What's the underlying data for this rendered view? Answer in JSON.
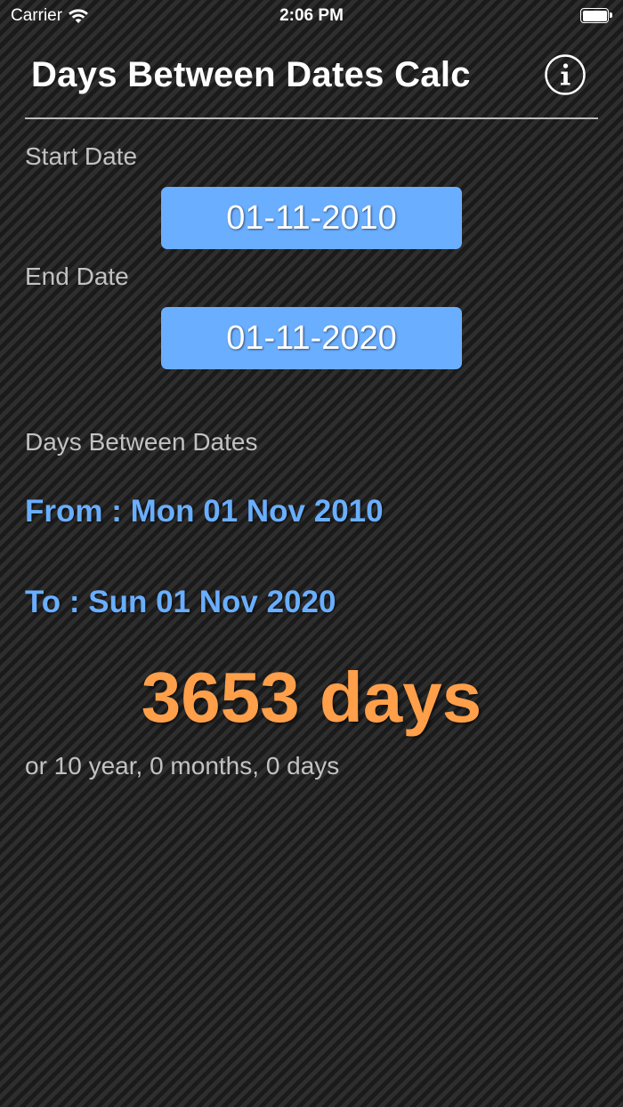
{
  "status_bar": {
    "carrier": "Carrier",
    "time": "2:06 PM",
    "wifi_icon": "wifi-icon",
    "battery_icon": "battery-full-icon"
  },
  "header": {
    "title": "Days Between Dates Calc",
    "info_icon": "info-icon"
  },
  "start": {
    "label": "Start Date",
    "value": "01-11-2010"
  },
  "end": {
    "label": "End Date",
    "value": "01-11-2020"
  },
  "result": {
    "label": "Days Between Dates",
    "from": "From : Mon 01 Nov 2010",
    "to": "To : Sun 01 Nov 2020",
    "total": "3653 days",
    "breakdown": "or 10 year, 0 months, 0 days"
  },
  "colors": {
    "accent_blue": "#6aaeff",
    "result_orange": "#ff9f4a",
    "label_gray": "#c2c2c2"
  }
}
